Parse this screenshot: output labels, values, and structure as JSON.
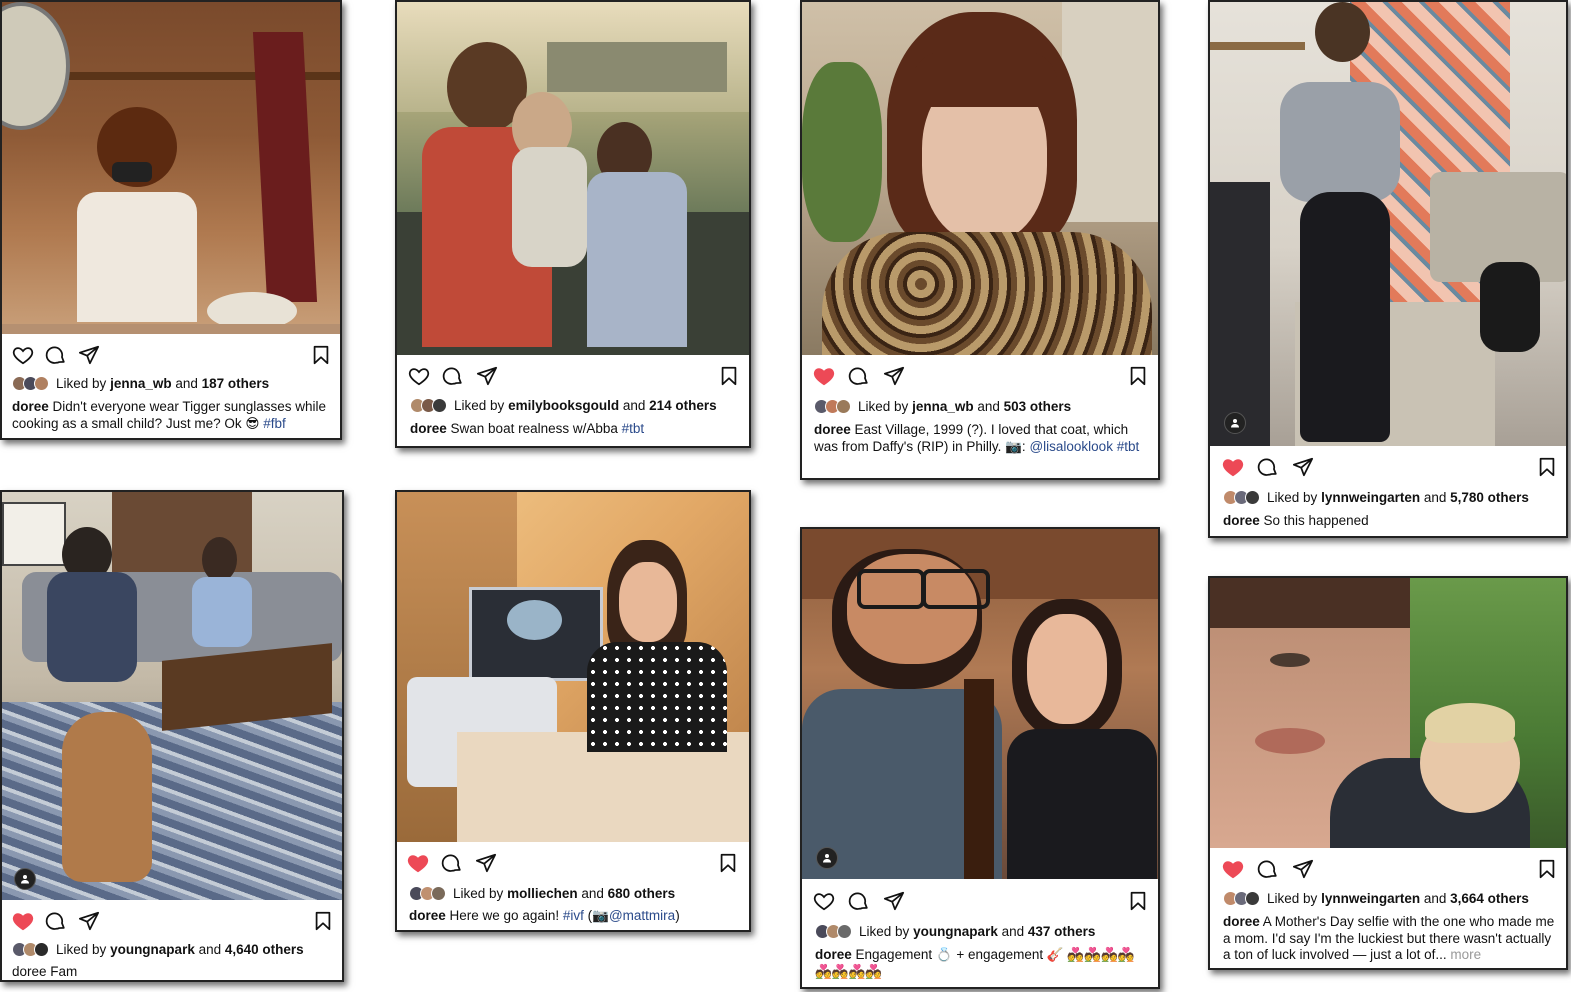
{
  "colors": {
    "heart_red": "#ed4956",
    "tag_blue": "#2a4a8a",
    "more_gray": "#999999"
  },
  "posts": [
    {
      "liked": false,
      "likes_prefix": "Liked by",
      "likes_user": "jenna_wb",
      "likes_and": "and",
      "likes_count": "187 others",
      "caption_user": "doree",
      "caption_text": "Didn't everyone wear Tigger sunglasses while cooking as a small child? Just me? Ok 😎",
      "caption_tag": "#fbf"
    },
    {
      "liked": false,
      "likes_prefix": "Liked by",
      "likes_user": "emilybooksgould",
      "likes_and": "and",
      "likes_count": "214 others",
      "caption_user": "doree",
      "caption_text": "Swan boat realness w/Abba",
      "caption_tag": "#tbt"
    },
    {
      "liked": true,
      "likes_prefix": "Liked by",
      "likes_user": "jenna_wb",
      "likes_and": "and",
      "likes_count": "503 others",
      "caption_user": "doree",
      "caption_text": "East Village, 1999 (?). I loved that coat, which was from Daffy's (RIP) in Philly. 📷:",
      "caption_mention": "@lisalooklook",
      "caption_tag": "#tbt"
    },
    {
      "liked": true,
      "likes_prefix": "Liked by",
      "likes_user": "lynnweingarten",
      "likes_and": "and",
      "likes_count": "5,780 others",
      "caption_user": "doree",
      "caption_text": "So this happened"
    },
    {
      "liked": true,
      "likes_prefix": "Liked by",
      "likes_user": "youngnapark",
      "likes_and": "and",
      "likes_count": "4,640 others",
      "caption_user": "doree",
      "caption_text": "Fam"
    },
    {
      "liked": true,
      "likes_prefix": "Liked by",
      "likes_user": "molliechen",
      "likes_and": "and",
      "likes_count": "680 others",
      "caption_user": "doree",
      "caption_text": "Here we go again!",
      "caption_tag": "#ivf",
      "caption_open": "(📷",
      "caption_mention": "@mattmira",
      "caption_close": ")"
    },
    {
      "liked": false,
      "likes_prefix": "Liked by",
      "likes_user": "youngnapark",
      "likes_and": "and",
      "likes_count": "437 others",
      "caption_user": "doree",
      "caption_text": "Engagement 💍 + engagement 🎸 💑💑💑💑💑💑💑💑"
    },
    {
      "liked": true,
      "likes_prefix": "Liked by",
      "likes_user": "lynnweingarten",
      "likes_and": "and",
      "likes_count": "3,664 others",
      "caption_user": "doree",
      "caption_text": "A Mother's Day selfie with the one who made me a mom. I'd say I'm the luckiest but there wasn't actually a ton of luck involved — just a lot of...",
      "caption_more": "more"
    }
  ]
}
